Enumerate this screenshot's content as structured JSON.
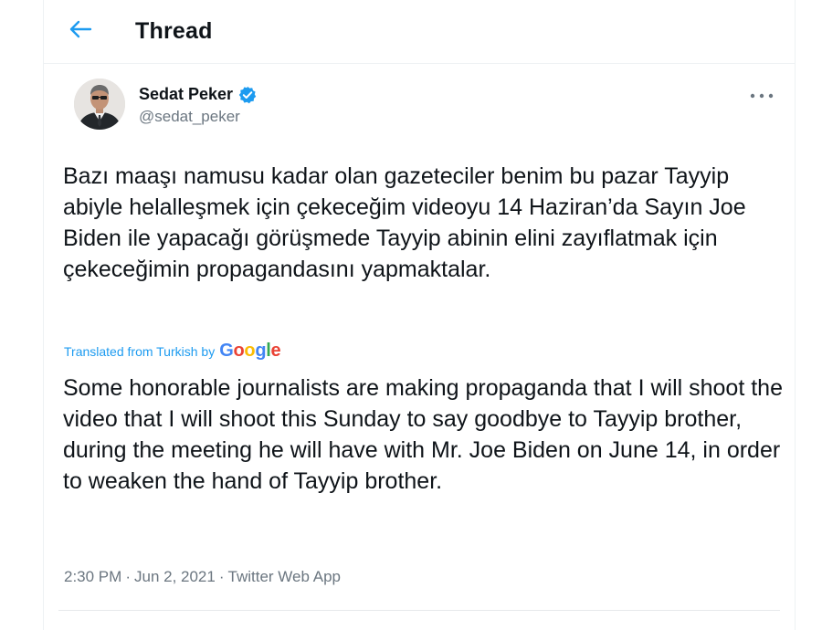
{
  "header": {
    "title": "Thread",
    "back_icon": "arrow-left-icon"
  },
  "author": {
    "name": "Sedat Peker",
    "handle": "@sedat_peker",
    "verified": true
  },
  "tweet": {
    "original_text": "Bazı maaşı namusu kadar olan gazeteciler benim bu pazar Tayyip abiyle helalleşmek için çekeceğim videoyu 14 Haziran’da Sayın Joe Biden ile yapacağı görüşmede Tayyip abinin elini zayıflatmak için çekeceğimin propagandasını yapmaktalar.",
    "translated_label": "Translated from Turkish by",
    "translation_provider": "Google",
    "translated_text": "Some honorable journalists are making propaganda that I will shoot the video that I will shoot this Sunday to say goodbye to Tayyip brother, during the meeting he will have with Mr. Joe Biden on June 14, in order to weaken the hand of Tayyip brother.",
    "time": "2:30 PM",
    "separator": "·",
    "date": "Jun 2, 2021",
    "source": "Twitter Web App"
  },
  "colors": {
    "accent": "#1d9bf0",
    "text": "#0f1419",
    "secondary": "#6b7680",
    "border": "#eef1f3"
  }
}
